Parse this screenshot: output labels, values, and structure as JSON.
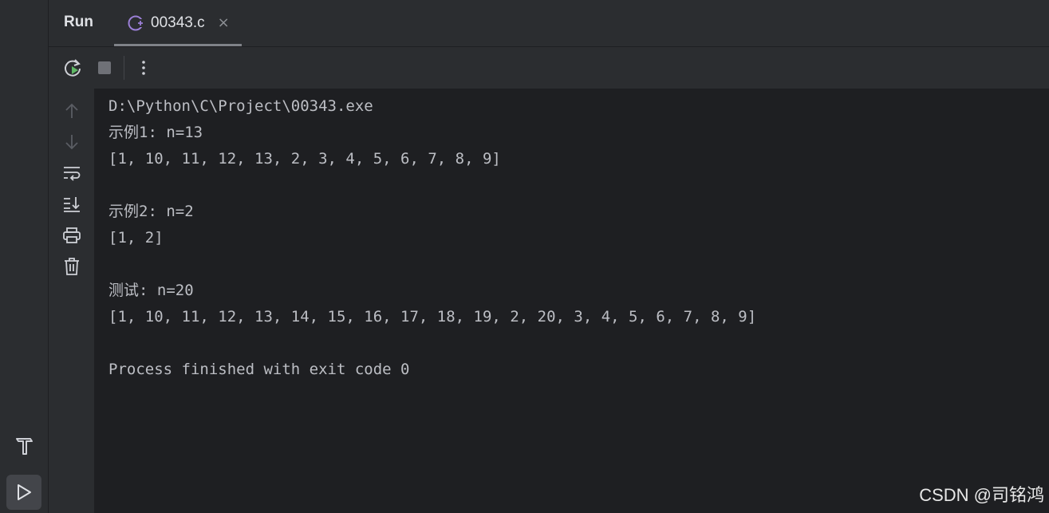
{
  "panel": {
    "title": "Run"
  },
  "tab": {
    "label": "00343.c",
    "icon": "c-file-icon",
    "close": "×"
  },
  "toolbar": {
    "rerun": "rerun-icon",
    "stop": "stop-icon",
    "more": "more-vertical-icon"
  },
  "gutter": [
    "arrow-up-icon",
    "arrow-down-icon",
    "soft-wrap-icon",
    "scroll-to-end-icon",
    "print-icon",
    "trash-icon"
  ],
  "console": {
    "lines": [
      "D:\\Python\\C\\Project\\00343.exe",
      "示例1: n=13",
      "[1, 10, 11, 12, 13, 2, 3, 4, 5, 6, 7, 8, 9]",
      "",
      "示例2: n=2",
      "[1, 2]",
      "",
      "测试: n=20",
      "[1, 10, 11, 12, 13, 14, 15, 16, 17, 18, 19, 2, 20, 3, 4, 5, 6, 7, 8, 9]",
      "",
      "Process finished with exit code 0"
    ]
  },
  "watermark": "CSDN @司铭鸿",
  "colors": {
    "background": "#1e1f22",
    "panel": "#2b2d30",
    "text": "#bcbec4",
    "accent_green": "#5fb865",
    "c_icon": "#9b7fd6"
  }
}
